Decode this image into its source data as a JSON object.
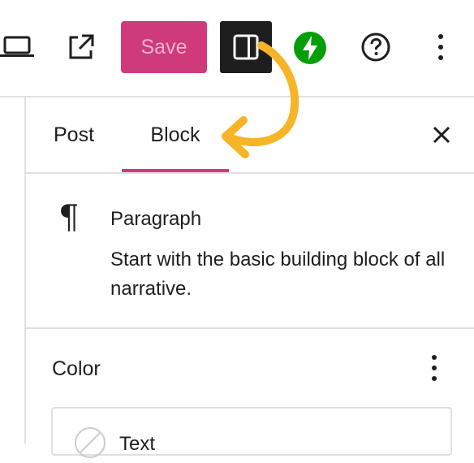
{
  "toolbar": {
    "save_label": "Save",
    "icons": [
      "laptop-icon",
      "external-link-icon",
      "sidebar-toggle-icon",
      "jetpack-icon",
      "help-icon",
      "more-options-icon"
    ]
  },
  "tabs": [
    {
      "label": "Post",
      "active": false
    },
    {
      "label": "Block",
      "active": true
    }
  ],
  "block": {
    "title": "Paragraph",
    "description": "Start with the basic building block of all narrative."
  },
  "color_panel": {
    "title": "Color",
    "items": [
      {
        "label": "Text"
      }
    ]
  },
  "colors": {
    "accent": "#cf3a7a",
    "jetpack": "#069e08",
    "annotation_arrow": "#f6b527",
    "dark": "#1e1e1e"
  }
}
